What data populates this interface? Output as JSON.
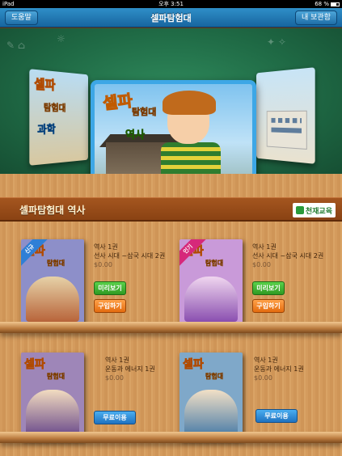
{
  "status": {
    "carrier": "iPad",
    "time": "오후 3:51",
    "battery": "68 %"
  },
  "nav": {
    "title": "셀파탐험대",
    "left_button": "도움말",
    "right_button": "내 보관함"
  },
  "carousel": {
    "left_cover": {
      "line1": "셀파",
      "line2": "탐험대",
      "subject": "과학"
    },
    "main_cover": {
      "line1": "셀파",
      "line2": "탐험대",
      "subject": "역사"
    }
  },
  "section": {
    "title": "셀파탐험대 역사",
    "publisher": "천재교육"
  },
  "books": [
    {
      "ribbon": "신규",
      "ribbon_color": "#2f7fd6",
      "title": "역사 1권",
      "subtitle": "선사 시대 ~삼국 시대 2권",
      "price": "$0.00",
      "preview": "미리보기",
      "buy": "구입하기",
      "cover_color": "#8d8fc9"
    },
    {
      "ribbon": "인기",
      "ribbon_color": "#d6287a",
      "title": "역사 1권",
      "subtitle": "선사 시대 ~삼국 시대 2권",
      "price": "$0.00",
      "preview": "미리보기",
      "buy": "구입하기",
      "cover_color": "#c99ad9"
    },
    {
      "title": "역사 1권",
      "subtitle": "운동과 에너지 1권",
      "price": "$0.00",
      "free": "무료이용",
      "cover_color": "#9e86b8"
    },
    {
      "title": "역사 1권",
      "subtitle": "운동과 에너지 1권",
      "price": "$0.00",
      "free": "무료이용",
      "cover_color": "#7fa8c9"
    }
  ]
}
